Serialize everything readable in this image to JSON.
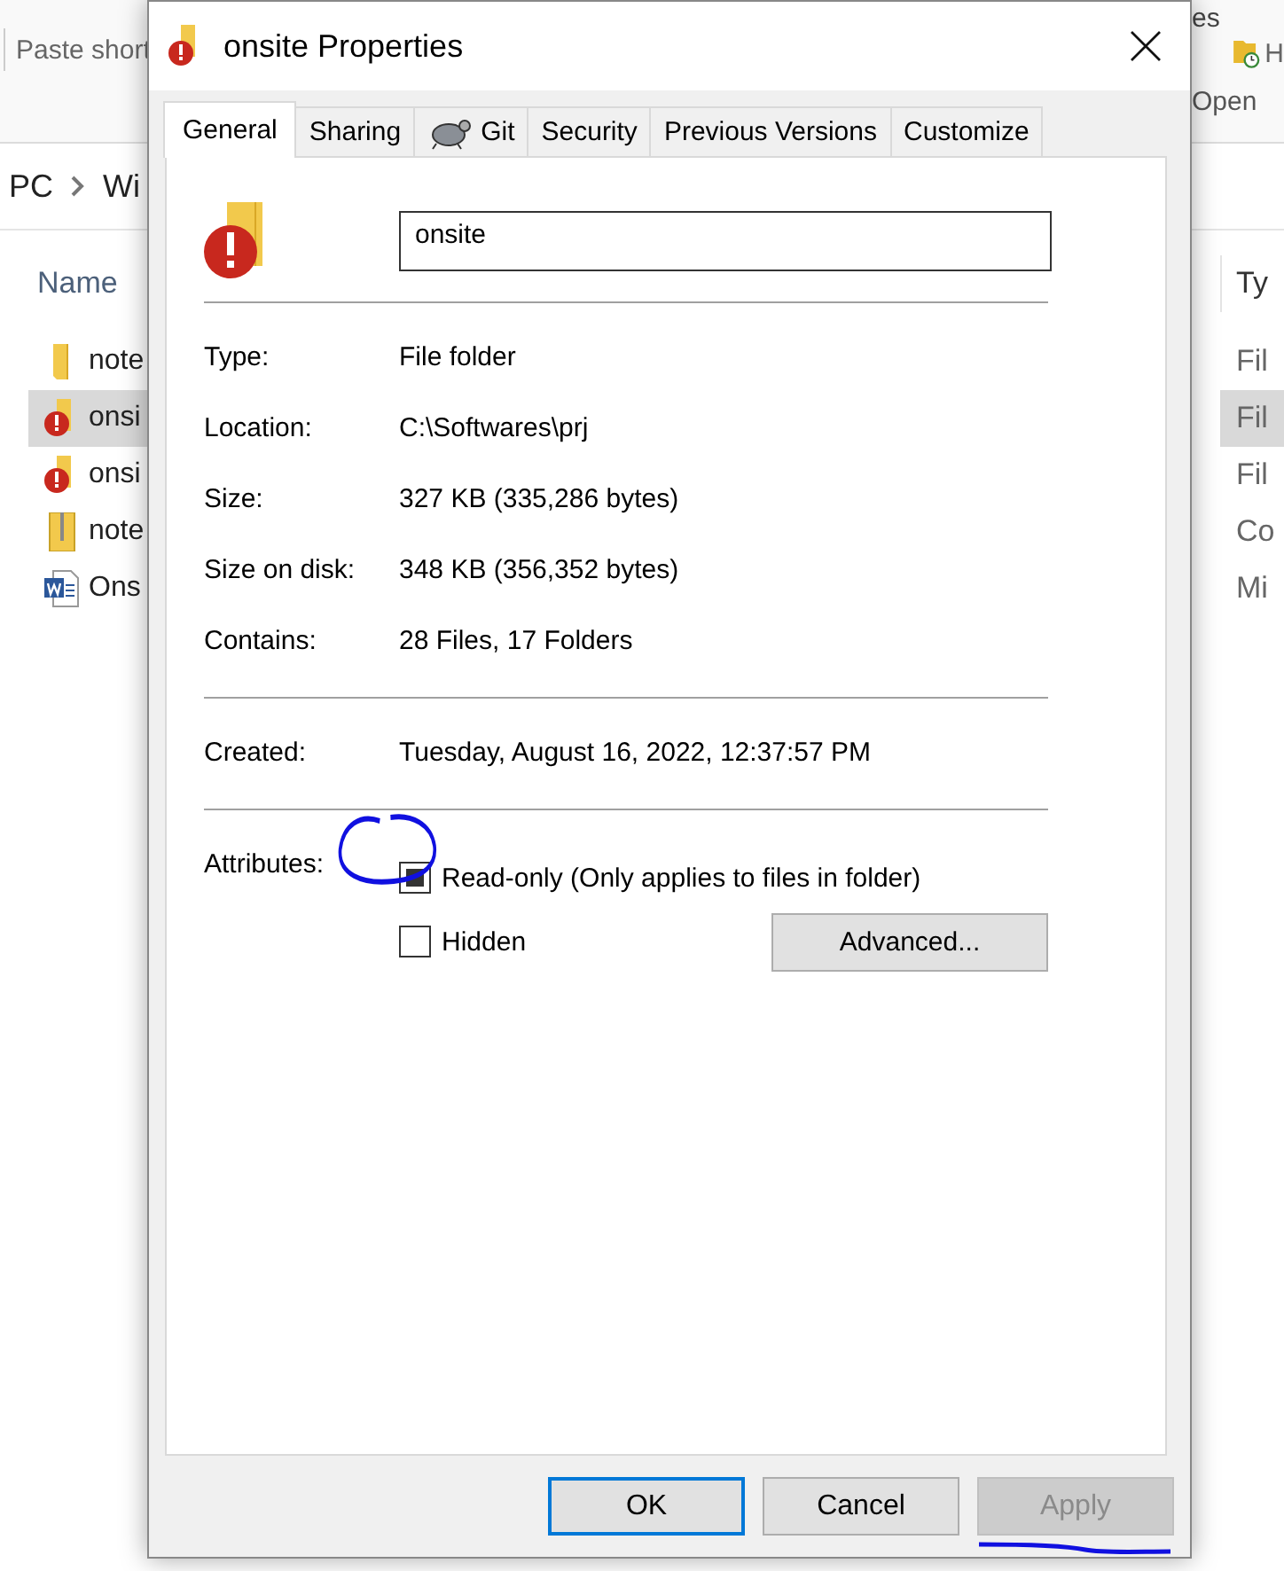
{
  "explorer": {
    "ribbon_left": "Paste short",
    "ribbon_right": [
      "es",
      "H",
      "Open"
    ],
    "address": [
      "PC",
      "Wi"
    ],
    "name_header": "Name",
    "type_header": "Ty",
    "files": [
      {
        "kind": "folder",
        "name": "note",
        "type": "Fil",
        "selected": false
      },
      {
        "kind": "warning-folder",
        "name": "onsi",
        "type": "Fil",
        "selected": true
      },
      {
        "kind": "warning-folder",
        "name": "onsi",
        "type": "Fil",
        "selected": false
      },
      {
        "kind": "zip",
        "name": "note",
        "type": "Co",
        "selected": false
      },
      {
        "kind": "word",
        "name": "Ons",
        "type": "Mi",
        "selected": false
      }
    ]
  },
  "dialog": {
    "title": "onsite Properties",
    "tabs": [
      {
        "label": "General",
        "selected": true,
        "icon": false
      },
      {
        "label": "Sharing",
        "selected": false,
        "icon": false
      },
      {
        "label": "Git",
        "selected": false,
        "icon": true
      },
      {
        "label": "Security",
        "selected": false,
        "icon": false
      },
      {
        "label": "Previous Versions",
        "selected": false,
        "icon": false
      },
      {
        "label": "Customize",
        "selected": false,
        "icon": false
      }
    ],
    "name_value": "onsite",
    "groups": [
      [
        {
          "label": "Type:",
          "value": "File folder"
        },
        {
          "label": "Location:",
          "value": "C:\\Softwares\\prj"
        },
        {
          "label": "Size:",
          "value": "327 KB (335,286 bytes)"
        },
        {
          "label": "Size on disk:",
          "value": "348 KB (356,352 bytes)"
        },
        {
          "label": "Contains:",
          "value": "28 Files, 17 Folders"
        }
      ],
      [
        {
          "label": "Created:",
          "value": "Tuesday, August 16, 2022, 12:37:57 PM"
        }
      ]
    ],
    "attributes_label": "Attributes:",
    "attributes": [
      {
        "label": "Read-only (Only applies to files in folder)",
        "indeterminate": true
      },
      {
        "label": "Hidden",
        "checked": false,
        "indeterminate": false
      }
    ],
    "advanced_button": "Advanced...",
    "buttons": [
      {
        "label": "OK",
        "default": true,
        "disabled": false
      },
      {
        "label": "Cancel",
        "default": false,
        "disabled": false
      },
      {
        "label": "Apply",
        "default": false,
        "disabled": true
      }
    ]
  }
}
